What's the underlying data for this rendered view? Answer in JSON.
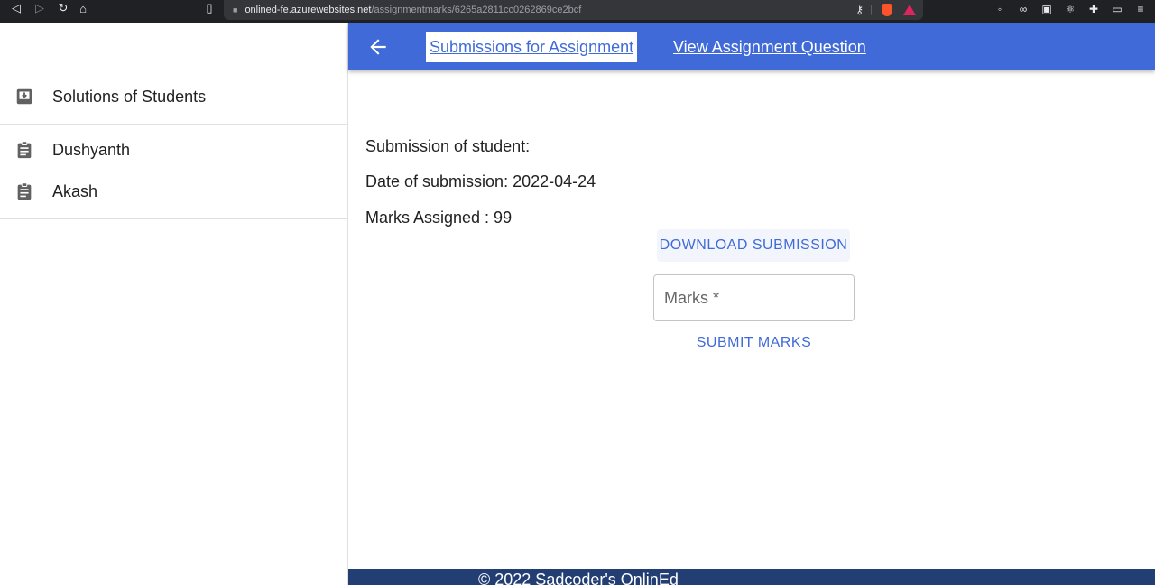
{
  "browser": {
    "url_host": "onlined-fe.azurewebsites.net",
    "url_path": "/assignmentmarks/6265a2811cc0262869ce2bcf"
  },
  "colors": {
    "primary": "#3f6ad8",
    "footer": "#223e73",
    "text": "#212121"
  },
  "sidebar": {
    "header": {
      "label": "Solutions of Students",
      "icon": "download-box-icon"
    },
    "students": [
      {
        "label": "Dushyanth",
        "icon": "clipboard-icon"
      },
      {
        "label": "Akash",
        "icon": "clipboard-icon"
      }
    ]
  },
  "appbar": {
    "back_icon": "arrow-back-icon",
    "tab_submissions": "Submissions for Assignment",
    "tab_question": "View Assignment Question"
  },
  "submission": {
    "student_label": "Submission of student:",
    "date_label": "Date of submission: 2022-04-24",
    "marks_label": "Marks Assigned : 99",
    "download_label": "DOWNLOAD SUBMISSION",
    "marks_placeholder": "Marks *",
    "submit_label": "SUBMIT MARKS"
  },
  "footer": {
    "text": "© 2022 Sadcoder's OnlinEd"
  }
}
